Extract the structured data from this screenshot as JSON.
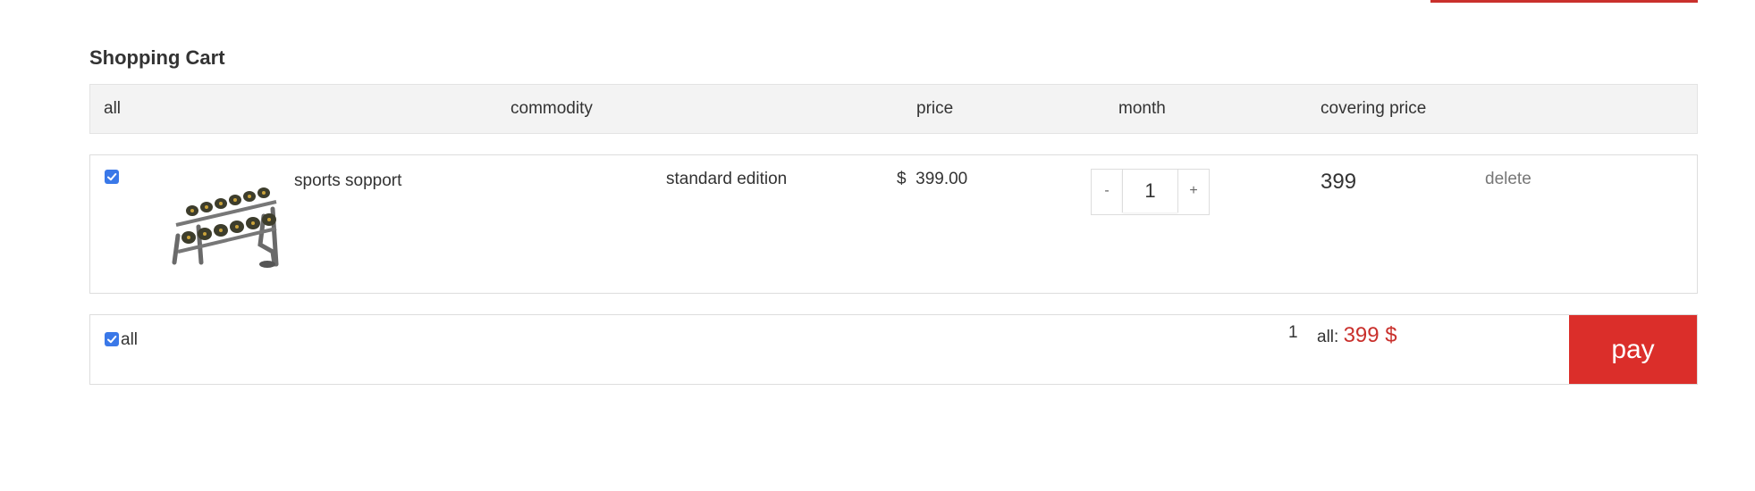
{
  "page": {
    "title": "Shopping Cart"
  },
  "header": {
    "all": "all",
    "commodity": "commodity",
    "price": "price",
    "month": "month",
    "covering_price": "covering price"
  },
  "cart": {
    "items": [
      {
        "checked": true,
        "name": "sports sopport",
        "edition": "standard edition",
        "price_symbol": "$",
        "price": "399.00",
        "quantity": "1",
        "minus_label": "-",
        "plus_label": "+",
        "subtotal": "399",
        "delete_label": "delete"
      }
    ]
  },
  "footer": {
    "select_all_checked": true,
    "select_all_label": "all",
    "count": "1",
    "total_label": "all:",
    "total_value": "399 $",
    "pay_label": "pay"
  },
  "colors": {
    "accent_red": "#db2e2a",
    "total_red": "#c9302c",
    "checkbox_blue": "#3a78e8",
    "header_bg": "#f3f3f3"
  },
  "icons": {
    "checkbox": "checkmark-icon",
    "product_image": "dumbbell-rack-image"
  }
}
